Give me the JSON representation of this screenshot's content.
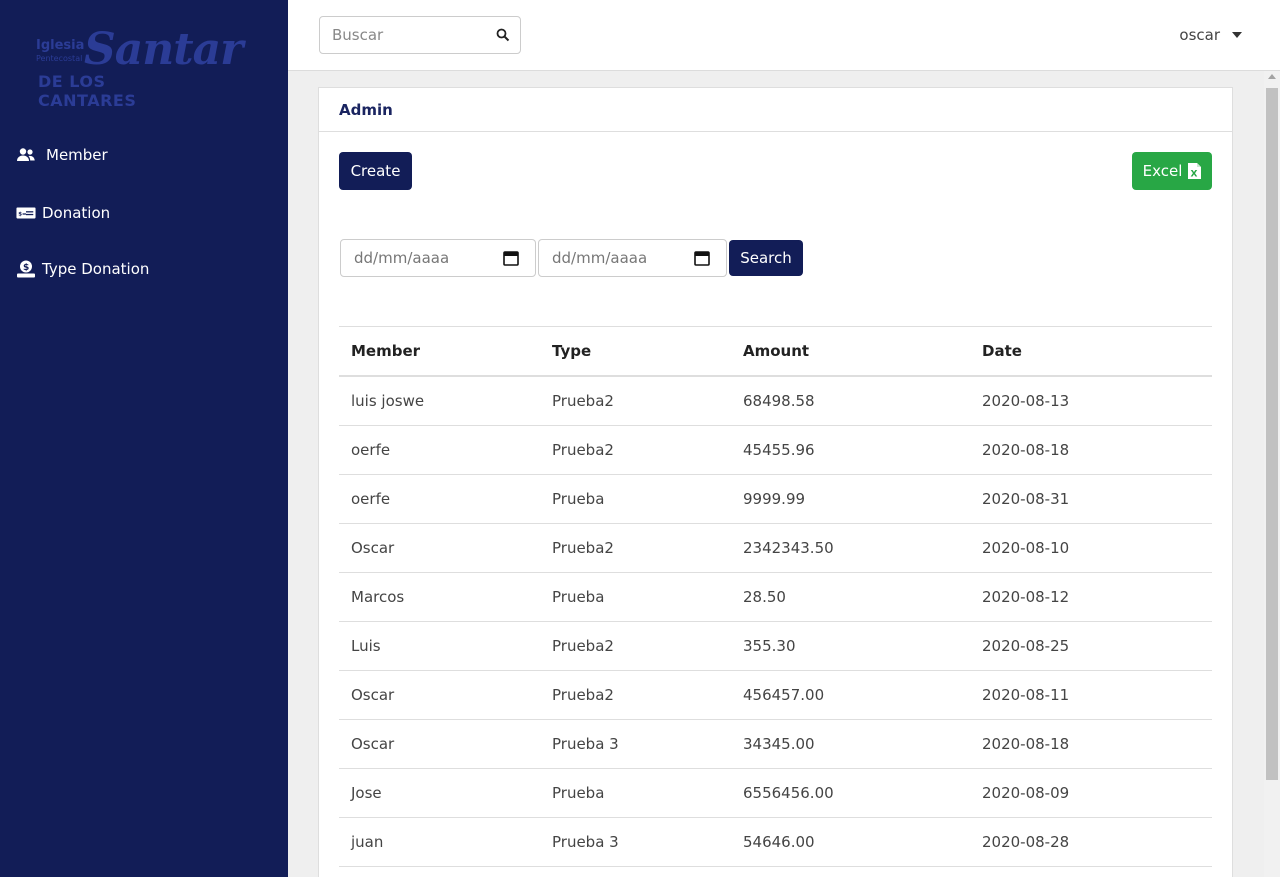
{
  "logo": {
    "line1": "Iglesia",
    "line1b": "Pentecostal",
    "script": "Santar",
    "line2": "DE LOS CANTARES"
  },
  "sidebar": {
    "items": [
      {
        "label": "Member",
        "icon": "users-icon"
      },
      {
        "label": "Donation",
        "icon": "money-bill-icon"
      },
      {
        "label": "Type Donation",
        "icon": "donate-icon"
      }
    ]
  },
  "topbar": {
    "search_placeholder": "Buscar",
    "user": "oscar"
  },
  "card": {
    "title": "Admin",
    "create_label": "Create",
    "excel_label": "Excel",
    "date_placeholder_from": "dd/mm/aaaa",
    "date_placeholder_to": "dd/mm/aaaa",
    "search_label": "Search"
  },
  "table": {
    "headers": [
      "Member",
      "Type",
      "Amount",
      "Date"
    ],
    "rows": [
      [
        "luis joswe",
        "Prueba2",
        "68498.58",
        "2020-08-13"
      ],
      [
        "oerfe",
        "Prueba2",
        "45455.96",
        "2020-08-18"
      ],
      [
        "oerfe",
        "Prueba",
        "9999.99",
        "2020-08-31"
      ],
      [
        "Oscar",
        "Prueba2",
        "2342343.50",
        "2020-08-10"
      ],
      [
        "Marcos",
        "Prueba",
        "28.50",
        "2020-08-12"
      ],
      [
        "Luis",
        "Prueba2",
        "355.30",
        "2020-08-25"
      ],
      [
        "Oscar",
        "Prueba2",
        "456457.00",
        "2020-08-11"
      ],
      [
        "Oscar",
        "Prueba 3",
        "34345.00",
        "2020-08-18"
      ],
      [
        "Jose",
        "Prueba",
        "6556456.00",
        "2020-08-09"
      ],
      [
        "juan",
        "Prueba 3",
        "54646.00",
        "2020-08-28"
      ]
    ]
  },
  "colors": {
    "sidebar_bg": "#121d57",
    "primary_button": "#121d57",
    "excel_button": "#28a745"
  }
}
